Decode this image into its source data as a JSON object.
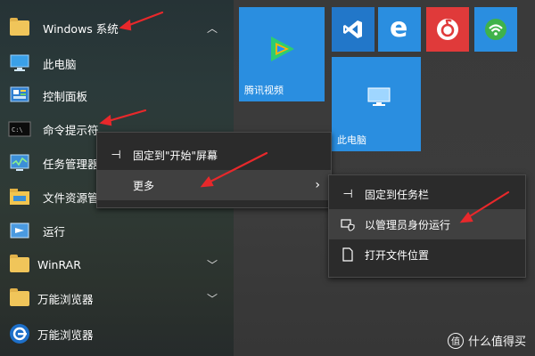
{
  "start_list": {
    "items": [
      {
        "label": "Windows 系统",
        "icon": "folder-icon",
        "expanded": true
      },
      {
        "label": "此电脑",
        "icon": "this-pc-icon"
      },
      {
        "label": "控制面板",
        "icon": "control-panel-icon"
      },
      {
        "label": "命令提示符",
        "icon": "cmd-icon"
      },
      {
        "label": "任务管理器",
        "icon": "task-manager-icon"
      },
      {
        "label": "文件资源管理器",
        "icon": "file-explorer-icon"
      },
      {
        "label": "运行",
        "icon": "run-icon"
      },
      {
        "label": "WinRAR",
        "icon": "folder-icon"
      },
      {
        "label": "万能浏览器",
        "icon": "folder-icon"
      },
      {
        "label": "万能浏览器",
        "icon": "browser-icon"
      }
    ]
  },
  "tiles": {
    "tencent_video": "腾讯视频",
    "this_pc": "此电脑"
  },
  "context_menu": {
    "pin_start": "固定到\"开始\"屏幕",
    "more": "更多"
  },
  "sub_menu": {
    "pin_taskbar": "固定到任务栏",
    "run_as_admin": "以管理员身份运行",
    "open_location": "打开文件位置"
  },
  "watermark": "什么值得买",
  "colors": {
    "tile_blue": "#2a8ee0",
    "netease_red": "#e03a3a",
    "wifi_green": "#3fb24a",
    "arrow_red": "#e8282b"
  }
}
